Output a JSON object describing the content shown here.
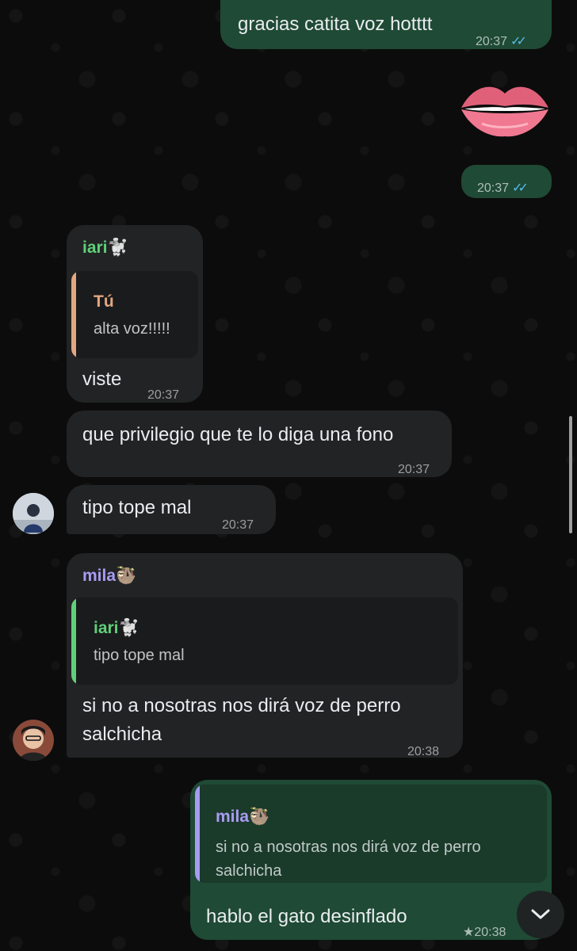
{
  "messages": {
    "m1": {
      "text": "gracias catita voz hotttt",
      "time": "20:37",
      "status": "read"
    },
    "m2": {
      "sticker": "lips",
      "time": "20:37",
      "status": "read"
    },
    "m3": {
      "sender": "iari🐩",
      "quote_author": "Tú",
      "quote_text": "alta voz!!!!!",
      "text": "viste",
      "time": "20:37"
    },
    "m4": {
      "text": "que privilegio que te lo diga una fono",
      "time": "20:37"
    },
    "m5": {
      "text": "tipo tope mal",
      "time": "20:37"
    },
    "m6": {
      "sender": "mila🦥",
      "quote_author": "iari🐩",
      "quote_text": "tipo tope mal",
      "text_line1": "si no a nosotras nos dirá voz de perro",
      "text_line2": "salchicha",
      "time": "20:38"
    },
    "m7": {
      "quote_author": "mila🦥",
      "quote_text_line1": "si no a nosotras nos dirá voz de perro",
      "quote_text_line2": "salchicha",
      "text": "hablo el gato desinflado",
      "star": "★",
      "time": "20:38"
    }
  },
  "colors": {
    "outgoing_bubble": "#1f4a35",
    "incoming_bubble": "#222324",
    "read_ticks": "#53bdeb",
    "name_iari": "#5fd07a",
    "name_mila": "#a89cf2",
    "quote_you": "#e3a781"
  },
  "icons": {
    "read_ticks": "✓✓",
    "scroll_down": "chevron-down-icon"
  }
}
